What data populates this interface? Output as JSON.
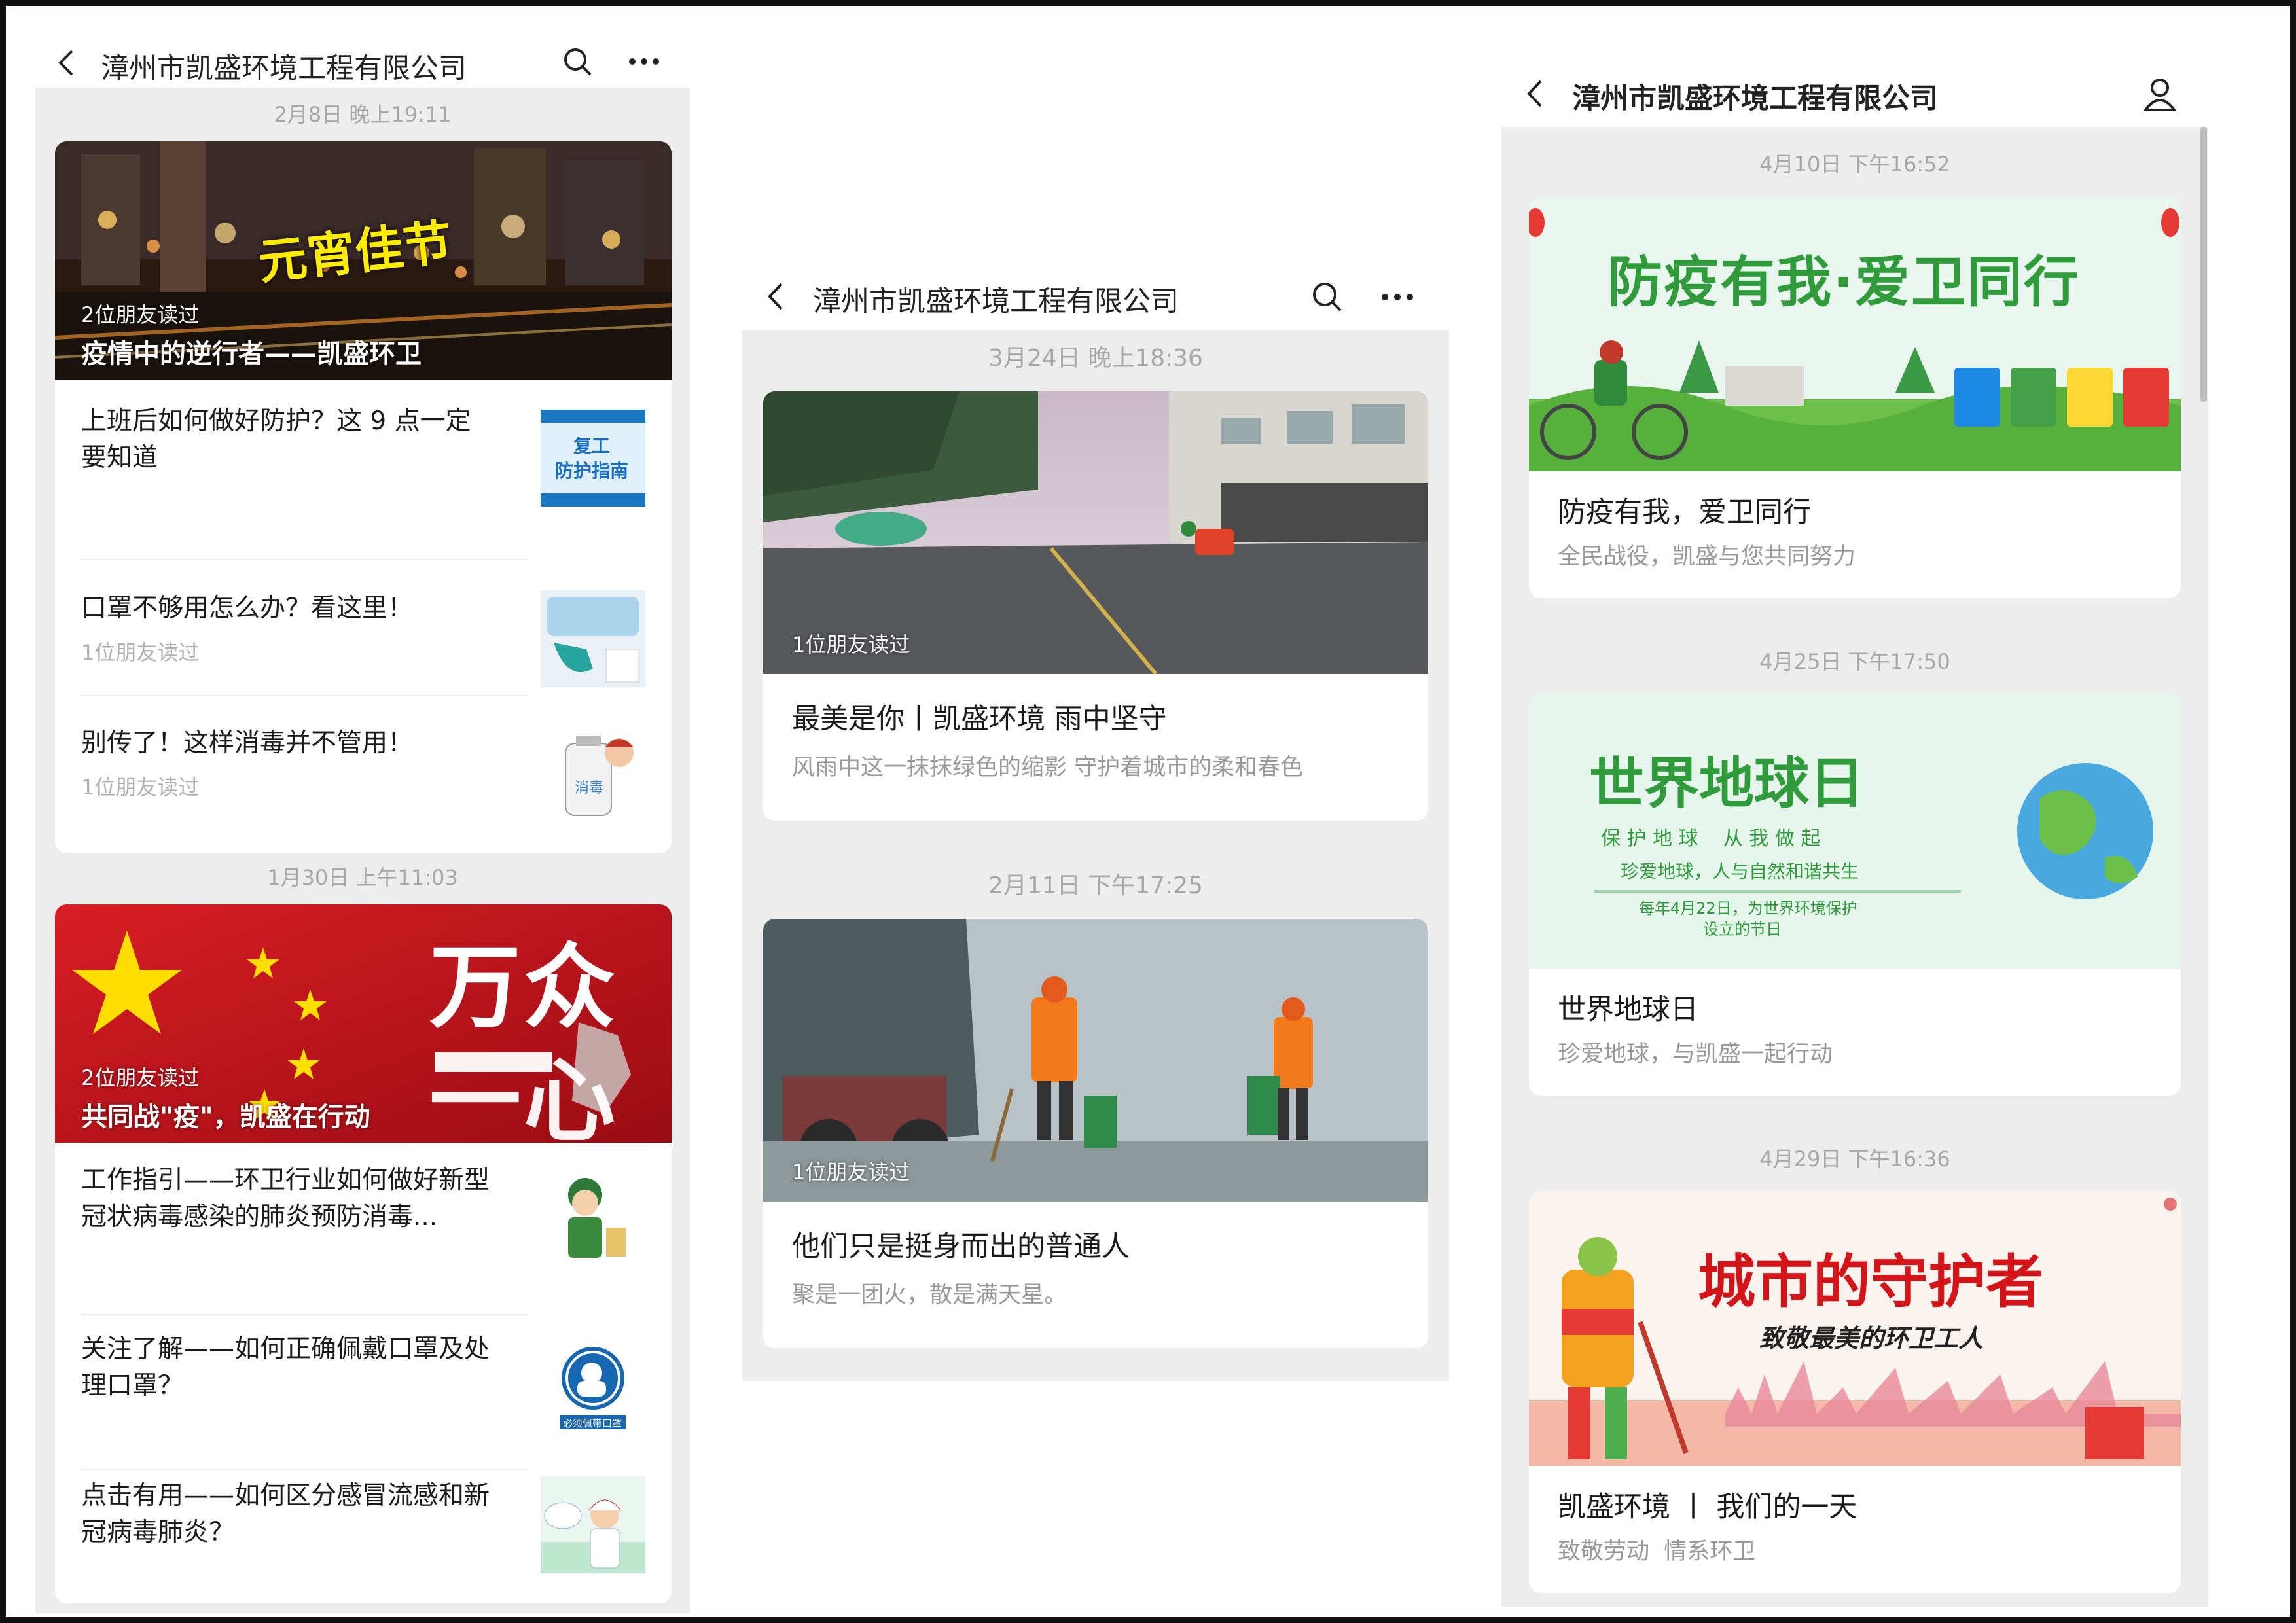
{
  "account_name": "漳州市凯盛环境工程有限公司",
  "left": {
    "groups": [
      {
        "timestamp": "2月8日 晚上19:11",
        "lead": {
          "read": "2位朋友读过",
          "title": "疫情中的逆行者——凯盛环卫",
          "art_text": "元宵佳节"
        },
        "items": [
          {
            "title_line1": "上班后如何做好防护？这 9 点一定",
            "title_line2": "要知道",
            "read": "",
            "thumb_text1": "复工",
            "thumb_text2": "防护指南"
          },
          {
            "title_line1": "口罩不够用怎么办？看这里！",
            "title_line2": "",
            "read": "1位朋友读过"
          },
          {
            "title_line1": "别传了！这样消毒并不管用！",
            "title_line2": "",
            "read": "1位朋友读过",
            "thumb_text1": "消毒"
          }
        ]
      },
      {
        "timestamp": "1月30日 上午11:03",
        "lead": {
          "read": "2位朋友读过",
          "title": "共同战\"疫\"，凯盛在行动",
          "art_text1": "万众",
          "art_text2": "一心"
        },
        "items": [
          {
            "title_line1": "工作指引——环卫行业如何做好新型",
            "title_line2": "冠状病毒感染的肺炎预防消毒..."
          },
          {
            "title_line1": "关注了解——如何正确佩戴口罩及处",
            "title_line2": "理口罩？",
            "thumb_text1": "必须佩带口罩"
          },
          {
            "title_line1": "点击有用——如何区分感冒流感和新",
            "title_line2": "冠病毒肺炎？"
          }
        ]
      }
    ]
  },
  "middle": {
    "posts": [
      {
        "timestamp": "3月24日 晚上18:36",
        "read": "1位朋友读过",
        "title": "最美是你丨凯盛环境   雨中坚守",
        "desc": "风雨中这一抹抹绿色的缩影 守护着城市的柔和春色"
      },
      {
        "timestamp": "2月11日 下午17:25",
        "read": "1位朋友读过",
        "title": "他们只是挺身而出的普通人",
        "desc": "聚是一团火，散是满天星。"
      }
    ]
  },
  "right": {
    "posts": [
      {
        "timestamp": "4月10日 下午16:52",
        "title": "防疫有我，爱卫同行",
        "desc": "全民战役，凯盛与您共同努力",
        "art_text": "防疫有我·爱卫同行"
      },
      {
        "timestamp": "4月25日 下午17:50",
        "title": "世界地球日",
        "desc": "珍爱地球，与凯盛一起行动",
        "art_title": "世界地球日",
        "art_line1": "保 护 地 球    从 我 做 起",
        "art_line2": "珍爱地球，人与自然和谐共生",
        "art_line3": "每年4月22日，为世界环境保护",
        "art_line4": "设立的节日"
      },
      {
        "timestamp": "4月29日 下午16:36",
        "title": "凯盛环境 丨 我们的一天",
        "desc": "致敬劳动  情系环卫",
        "art_title": "城市的守护者",
        "art_sub": "致敬最美的环卫工人"
      }
    ]
  },
  "colors": {
    "panel_bg": "#ededed",
    "card_bg": "#ffffff",
    "meta_text": "#a8a8a8",
    "flag_red": "#c8161d",
    "star_yellow": "#ffde00",
    "eco_green": "#2f9b3a"
  },
  "icons": [
    "back-arrow-icon",
    "search-icon",
    "more-icon",
    "profile-icon"
  ]
}
